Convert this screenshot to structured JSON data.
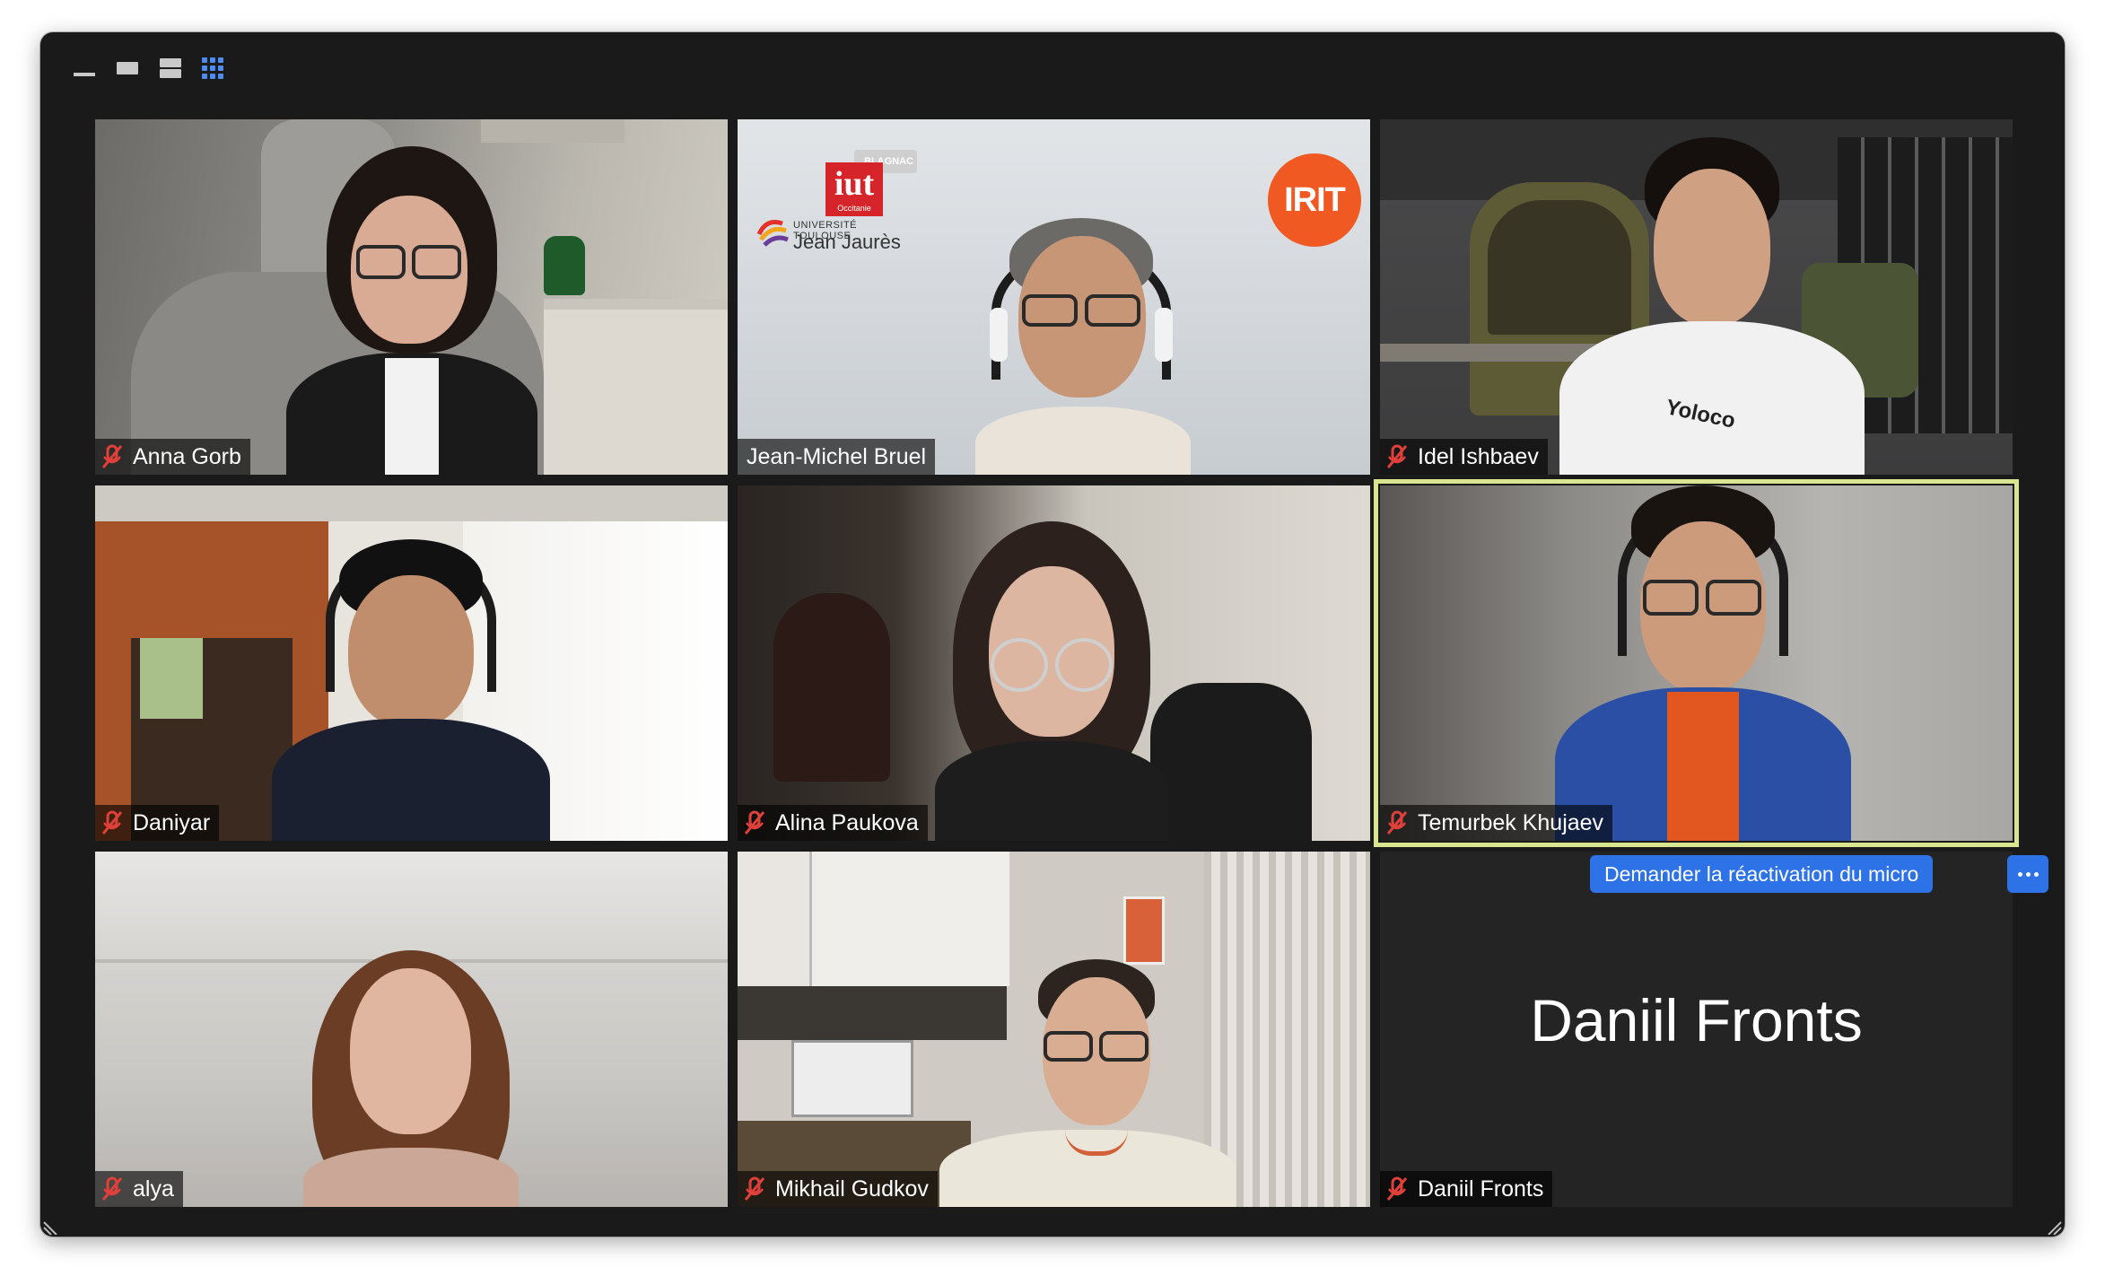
{
  "toolbar": {
    "views": [
      {
        "name": "minimize",
        "active": false
      },
      {
        "name": "single",
        "active": false
      },
      {
        "name": "stacked",
        "active": false
      },
      {
        "name": "grid",
        "active": true
      }
    ],
    "accent": "#4d8cf5"
  },
  "participants": [
    {
      "name": "Anna Gorb",
      "muted": true
    },
    {
      "name": "Jean-Michel Bruel",
      "muted": false
    },
    {
      "name": "Idel Ishbaev",
      "muted": true
    },
    {
      "name": "Daniyar",
      "muted": true
    },
    {
      "name": "Alina Paukova",
      "muted": true
    },
    {
      "name": "Temurbek Khujaev",
      "muted": true,
      "active_speaker": true
    },
    {
      "name": "alya",
      "muted": true
    },
    {
      "name": "Mikhail Gudkov",
      "muted": true
    },
    {
      "name": "Daniil Fronts",
      "muted": true,
      "video_off": true
    }
  ],
  "presenter_logos": {
    "iut_badge": "BLAGNAC",
    "iut_text": "iut",
    "iut_sub": "Occitanie",
    "university_line1": "UNIVERSITÉ TOULOUSE",
    "university_line2": "Jean Jaurès",
    "lab": "IRIT"
  },
  "shirt_text": "Yoloco",
  "actions": {
    "ask_unmute": "Demander la réactivation du micro",
    "more": "more-options",
    "button_color": "#2d72e6"
  },
  "colors": {
    "window_bg": "#1a1a1a",
    "active_speaker_border": "#d9e58f",
    "muted_icon": "#e0403a"
  }
}
